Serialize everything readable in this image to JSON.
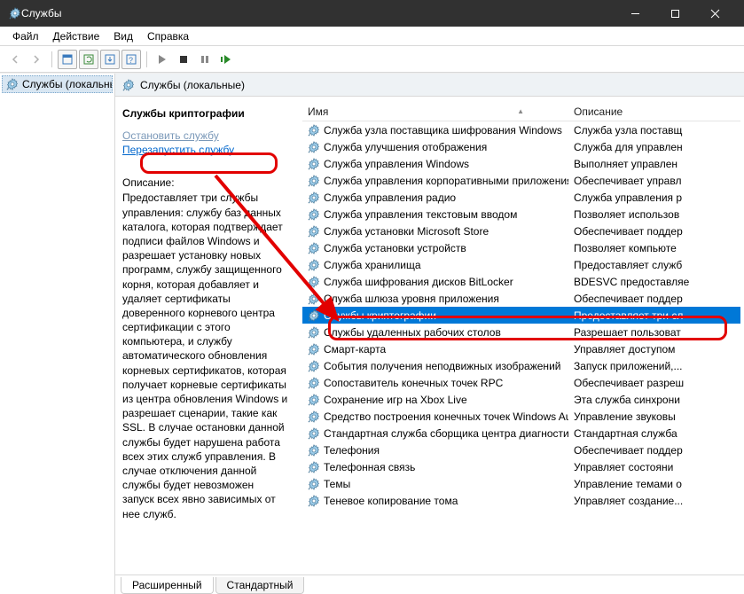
{
  "window": {
    "title": "Службы"
  },
  "menu": {
    "file": "Файл",
    "action": "Действие",
    "view": "Вид",
    "help": "Справка"
  },
  "nav": {
    "local_services": "Службы (локальные)"
  },
  "content": {
    "header": "Службы (локальные)"
  },
  "columns": {
    "name": "Имя",
    "description": "Описание"
  },
  "detail": {
    "title": "Службы криптографии",
    "stop": "Остановить службу",
    "restart": "Перезапустить службу",
    "desc_label": "Описание:",
    "desc": "Предоставляет три службы управления: службу баз данных каталога, которая подтверждает подписи файлов Windows и разрешает установку новых программ, службу защищенного корня, которая добавляет и удаляет сертификаты доверенного корневого центра сертификации с этого компьютера, и службу автоматического обновления корневых сертификатов, которая получает корневые сертификаты из центра обновления Windows и разрешает сценарии, такие как SSL. В случае остановки данной службы будет нарушена работа всех этих служб управления. В случае отключения данной службы будет невозможен запуск всех явно зависимых от нее служб."
  },
  "services": [
    {
      "name": "Служба узла поставщика шифрования Windows",
      "desc": "Служба узла поставщ"
    },
    {
      "name": "Служба улучшения отображения",
      "desc": "Служба для управлен"
    },
    {
      "name": "Служба управления Windows",
      "desc": "Выполняет управлен"
    },
    {
      "name": "Служба управления корпоративными приложения...",
      "desc": "Обеспечивает управл"
    },
    {
      "name": "Служба управления радио",
      "desc": "Служба управления р"
    },
    {
      "name": "Служба управления текстовым вводом",
      "desc": "Позволяет использов"
    },
    {
      "name": "Служба установки Microsoft Store",
      "desc": "Обеспечивает поддер"
    },
    {
      "name": "Служба установки устройств",
      "desc": "Позволяет компьюте"
    },
    {
      "name": "Служба хранилища",
      "desc": "Предоставляет служб"
    },
    {
      "name": "Служба шифрования дисков BitLocker",
      "desc": "BDESVC предоставляе"
    },
    {
      "name": "Служба шлюза уровня приложения",
      "desc": "Обеспечивает поддер"
    },
    {
      "name": "Службы криптографии",
      "desc": "Предоставляет три сл",
      "selected": true
    },
    {
      "name": "Службы удаленных рабочих столов",
      "desc": "Разрешает пользоват"
    },
    {
      "name": "Смарт-карта",
      "desc": "Управляет доступом"
    },
    {
      "name": "События получения неподвижных изображений",
      "desc": "Запуск приложений,..."
    },
    {
      "name": "Сопоставитель конечных точек RPC",
      "desc": "Обеспечивает разреш"
    },
    {
      "name": "Сохранение игр на Xbox Live",
      "desc": "Эта служба синхрони"
    },
    {
      "name": "Средство построения конечных точек Windows Audio",
      "desc": "Управление звуковы"
    },
    {
      "name": "Стандартная служба сборщика центра диагностики...",
      "desc": "Стандартная служба"
    },
    {
      "name": "Телефония",
      "desc": "Обеспечивает поддер"
    },
    {
      "name": "Телефонная связь",
      "desc": "Управляет состояни"
    },
    {
      "name": "Темы",
      "desc": "Управление темами о"
    },
    {
      "name": "Теневое копирование тома",
      "desc": "Управляет создание..."
    }
  ],
  "tabs": {
    "extended": "Расширенный",
    "standard": "Стандартный"
  }
}
